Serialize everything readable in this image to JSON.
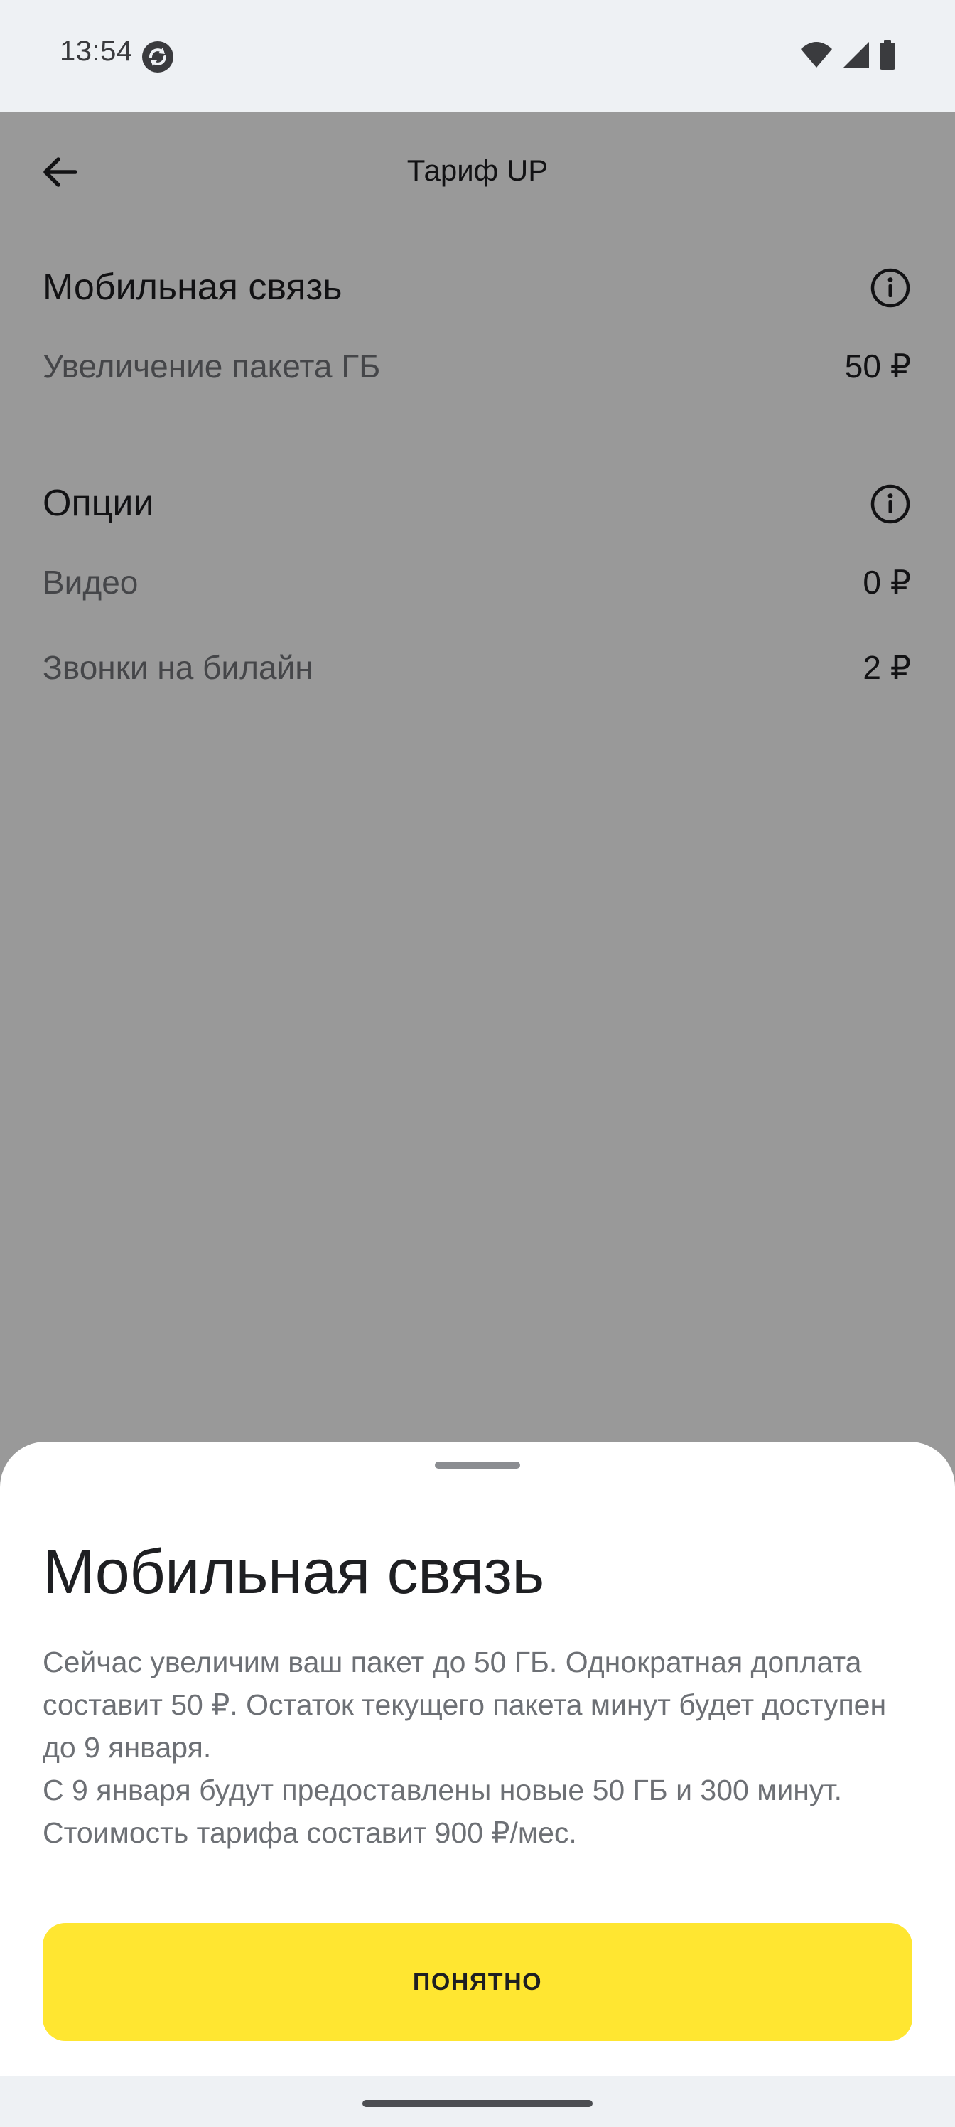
{
  "status_bar": {
    "time": "13:54",
    "sync_icon": "sync-icon",
    "right_icons": [
      "wifi-icon",
      "cellular-signal-icon",
      "battery-icon"
    ]
  },
  "header": {
    "title": "Тариф UP",
    "back_icon": "arrow-left-icon"
  },
  "sections": {
    "mobile": {
      "title": "Мобильная связь",
      "rows": [
        {
          "label": "Увеличение пакета ГБ",
          "value": "50 ₽"
        }
      ]
    },
    "options": {
      "title": "Опции",
      "rows": [
        {
          "label": "Видео",
          "value": "0 ₽"
        },
        {
          "label": "Звонки на билайн",
          "value": "2 ₽"
        }
      ]
    }
  },
  "sheet": {
    "title": "Мобильная связь",
    "lines": [
      "Сейчас увеличим ваш пакет до 50 ГБ. Однократная доплата составит 50 ₽. Остаток текущего пакета минут будет доступен до 9 января.",
      "С 9 января будут предоставлены новые 50 ГБ и 300 минут. Стоимость тарифа составит 900 ₽/мес."
    ],
    "button_label": "ПОНЯТНО"
  },
  "colors": {
    "accent": "#ffe631",
    "scrim": "#000000",
    "secondary_text": "#73767b"
  }
}
